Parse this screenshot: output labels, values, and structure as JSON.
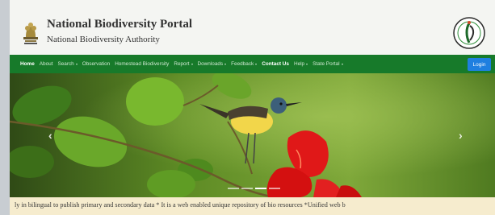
{
  "header": {
    "title": "National Biodiversity Portal",
    "subtitle": "National Biodiversity Authority",
    "emblem_icon": "national-emblem-icon",
    "logo_icon": "nba-logo-icon"
  },
  "nav": {
    "items": [
      {
        "label": "Home",
        "active": true,
        "dropdown": false
      },
      {
        "label": "About",
        "dropdown": false
      },
      {
        "label": "Search",
        "dropdown": true
      },
      {
        "label": "Observation",
        "dropdown": false
      },
      {
        "label": "Homestead Biodiversity",
        "dropdown": false
      },
      {
        "label": "Report",
        "dropdown": true
      },
      {
        "label": "Downloads",
        "dropdown": true
      },
      {
        "label": "Feedback",
        "dropdown": true
      },
      {
        "label": "Contact Us",
        "dropdown": false
      },
      {
        "label": "Help",
        "dropdown": true
      },
      {
        "label": "State Portal",
        "dropdown": true
      }
    ],
    "login_label": "Login"
  },
  "slider": {
    "next_label": "›",
    "prev_label": "‹",
    "slide_count": 4,
    "active_index": 2
  },
  "ticker": {
    "text": "ly in bilingual to publish primary and secondary data * It is a web enabled unique repository of bio resources *Unified web b"
  },
  "colors": {
    "nav_bg": "#177a2a",
    "login_bg": "#1f7fe0",
    "ticker_bg": "#f6ecce",
    "header_bg": "#f4f5f2"
  }
}
